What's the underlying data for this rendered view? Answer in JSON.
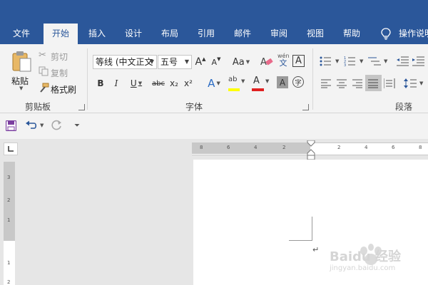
{
  "tabs": [
    {
      "label": "文件"
    },
    {
      "label": "开始",
      "active": true
    },
    {
      "label": "插入"
    },
    {
      "label": "设计"
    },
    {
      "label": "布局"
    },
    {
      "label": "引用"
    },
    {
      "label": "邮件"
    },
    {
      "label": "审阅"
    },
    {
      "label": "视图"
    },
    {
      "label": "帮助"
    }
  ],
  "tell_me": {
    "label": "操作说明",
    "icon": "lightbulb-icon"
  },
  "clipboard": {
    "paste_label": "粘贴",
    "cut_label": "剪切",
    "copy_label": "复制",
    "format_painter_label": "格式刷",
    "group_label": "剪贴板"
  },
  "font": {
    "font_name": "等线 (中文正文",
    "font_size": "五号",
    "grow_glyph": "A",
    "shrink_glyph": "A",
    "case_glyph": "Aa",
    "pinyin_top": "wén",
    "pinyin_bottom": "文",
    "border_glyph": "A",
    "bold_glyph": "B",
    "italic_glyph": "I",
    "underline_glyph": "U",
    "strike_glyph": "abc",
    "sub_glyph": "x₂",
    "sup_glyph": "x²",
    "effect_glyph": "A",
    "highlight_glyph": "ab",
    "color_glyph": "A",
    "shade_glyph": "A",
    "enclose_glyph": "字",
    "group_label": "字体"
  },
  "paragraph": {
    "group_label": "段落"
  },
  "ruler": {
    "h_left": [
      "8",
      "6",
      "4",
      "2"
    ],
    "h_right": [
      "2",
      "4",
      "6",
      "8"
    ],
    "v_ticks": [
      "3",
      "2",
      "1",
      "1",
      "2"
    ]
  },
  "watermark": {
    "brand": "Baidu 经验",
    "url": "jingyan.baidu.com"
  },
  "colors": {
    "accent": "#2b579a",
    "ribbon": "#f3f3f3",
    "highlight_yellow": "#ffff00",
    "font_red": "#e02020",
    "save_purple": "#7b3fa0"
  }
}
